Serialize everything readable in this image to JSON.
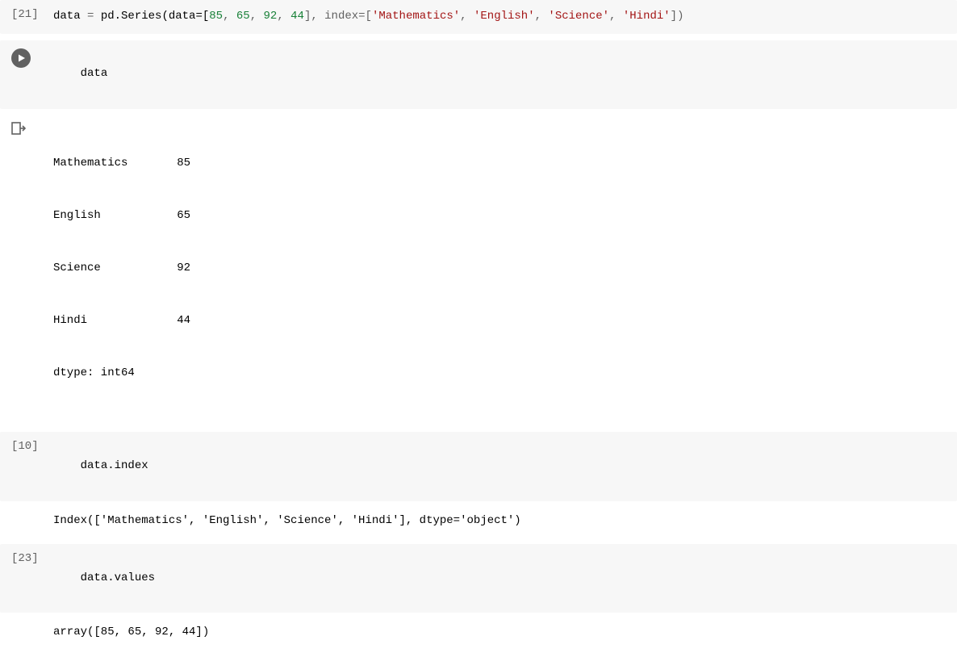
{
  "cells": {
    "c0": {
      "prompt": "[21]",
      "code_parts": {
        "p0": "data",
        "p1": " = ",
        "p2": "pd.Series(data=[",
        "n0": "85",
        "c0": ", ",
        "n1": "65",
        "c1": ", ",
        "n2": "92",
        "c2": ", ",
        "n3": "44",
        "c3": "], index=[",
        "s0": "'Mathematics'",
        "c4": ", ",
        "s1": "'English'",
        "c5": ", ",
        "s2": "'Science'",
        "c6": ", ",
        "s3": "'Hindi'",
        "c7": "])"
      }
    },
    "c1": {
      "code": "data",
      "output": {
        "rows": [
          {
            "label": "Mathematics",
            "value": "85"
          },
          {
            "label": "English",
            "value": "65"
          },
          {
            "label": "Science",
            "value": "92"
          },
          {
            "label": "Hindi",
            "value": "44"
          }
        ],
        "dtype": "dtype: int64"
      }
    },
    "c2": {
      "prompt": "[10]",
      "code": "data.index",
      "output": "Index(['Mathematics', 'English', 'Science', 'Hindi'], dtype='object')"
    },
    "c3": {
      "prompt": "[23]",
      "code": "data.values",
      "output": "array([85, 65, 92, 44])"
    }
  }
}
